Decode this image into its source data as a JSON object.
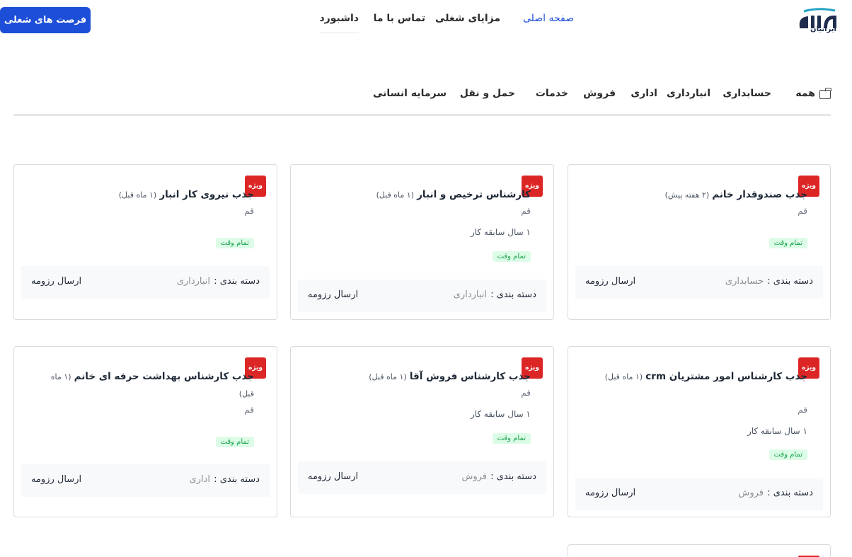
{
  "header": {
    "logo_text": "ایرانیان",
    "nav": [
      "صفحه اصلی",
      "مزایای شغلی",
      "تماس با ما",
      "داشبورد"
    ],
    "cta_label": "فرصت های شغلی"
  },
  "categories": [
    "همه",
    "حسابداری",
    "انبارداری",
    "اداری",
    "فروش",
    "خدمات",
    "حمل و نقل",
    "سرمایه انسانی"
  ],
  "jobs": [
    {
      "badge": "ویژه",
      "title": "جذب صندوقدار خانم",
      "ago": "(۲ هفته پیش)",
      "location": "قم",
      "experience": "",
      "type": "تمام وقت",
      "category_label": "دسته بندی :",
      "category": "حسابداری",
      "apply": "ارسال رزومه"
    },
    {
      "badge": "ویژه",
      "title": "کارشناس ترخیص و انبار",
      "ago": "(۱ ماه قبل)",
      "location": "قم",
      "experience": "۱ سال سابقه کار",
      "type": "تمام وقت",
      "category_label": "دسته بندی :",
      "category": "انبارداری",
      "apply": "ارسال رزومه"
    },
    {
      "badge": "ویژه",
      "title": "جذب نیروی کار انبار",
      "ago": "(۱ ماه قبل)",
      "location": "قم",
      "experience": "",
      "type": "تمام وقت",
      "category_label": "دسته بندی :",
      "category": "انبارداری",
      "apply": "ارسال رزومه"
    },
    {
      "badge": "ویژه",
      "title": "جذب کارشناس امور مشتریان crm",
      "ago": "(۱ ماه قبل)",
      "location": "قم",
      "experience": "۱ سال سابقه کار",
      "type": "تمام وقت",
      "category_label": "دسته بندی :",
      "category": "فروش",
      "apply": "ارسال رزومه"
    },
    {
      "badge": "ویژه",
      "title": "جذب کارشناس فروش آقا",
      "ago": "(۱ ماه قبل)",
      "location": "قم",
      "experience": "۱ سال سابقه کار",
      "type": "تمام وقت",
      "category_label": "دسته بندی :",
      "category": "فروش",
      "apply": "ارسال رزومه"
    },
    {
      "badge": "ویژه",
      "title": "جذب کارشناس بهداشت حرفه ای خانم",
      "ago": "(۱ ماه قبل)",
      "location": "قم",
      "experience": "",
      "type": "تمام وقت",
      "category_label": "دسته بندی :",
      "category": "اداری",
      "apply": "ارسال رزومه"
    }
  ],
  "colors": {
    "accent": "#1d4ed8",
    "badge": "#dc2626",
    "tag_bg": "#dcfce7",
    "tag_text": "#16a34a"
  }
}
